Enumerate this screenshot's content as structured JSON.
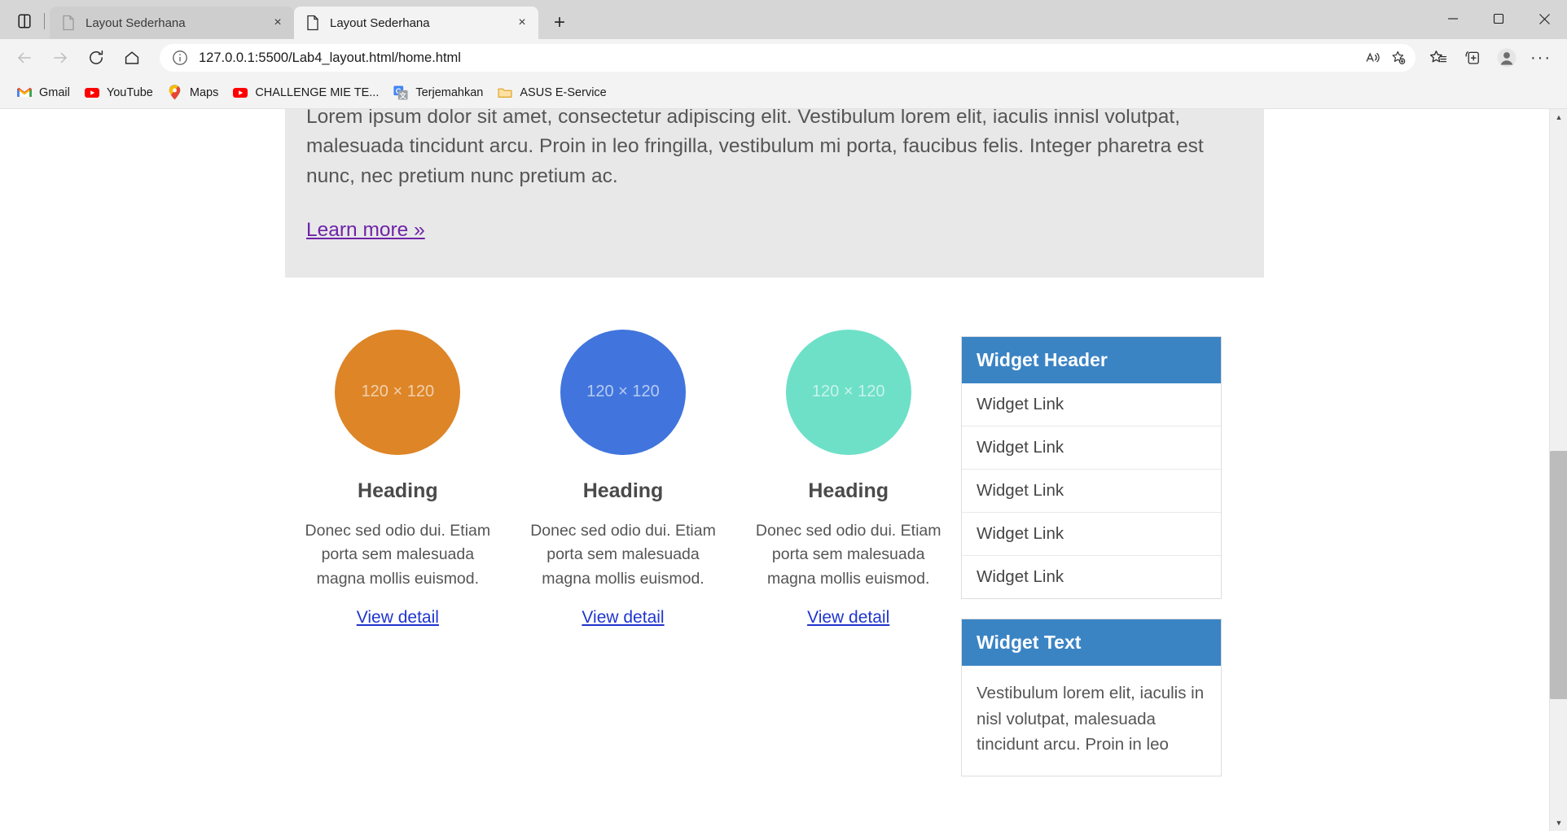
{
  "window": {
    "controls": {
      "minimize": "minimize-icon",
      "maximize": "maximize-icon",
      "close": "close-icon"
    }
  },
  "tabs": {
    "tab_search_label": "tab-actions-icon",
    "items": [
      {
        "title": "Layout Sederhana",
        "active": false,
        "close_label": "×"
      },
      {
        "title": "Layout Sederhana",
        "active": true,
        "close_label": "×"
      }
    ],
    "new_tab_label": "+"
  },
  "toolbar": {
    "back_label": "back-icon",
    "forward_label": "forward-icon",
    "refresh_label": "refresh-icon",
    "home_label": "home-icon",
    "url": "127.0.0.1:5500/Lab4_layout.html/home.html",
    "url_host": "127.0.0.1",
    "url_rest": ":5500/Lab4_layout.html/home.html",
    "read_aloud_label": "read-aloud-icon",
    "add_favorite_label": "add-favorite-icon",
    "favorites_label": "favorites-icon",
    "collections_label": "collections-icon",
    "profile_label": "profile-icon",
    "settings_label": "···"
  },
  "bookmarks": [
    {
      "label": "Gmail",
      "icon": "gmail-icon"
    },
    {
      "label": "YouTube",
      "icon": "youtube-icon"
    },
    {
      "label": "Maps",
      "icon": "google-maps-icon"
    },
    {
      "label": "CHALLENGE MIE TE...",
      "icon": "youtube-icon"
    },
    {
      "label": "Terjemahkan",
      "icon": "google-translate-icon"
    },
    {
      "label": "ASUS E-Service",
      "icon": "folder-icon"
    }
  ],
  "page": {
    "jumbotron": {
      "paragraph": "Lorem ipsum dolor sit amet, consectetur adipiscing elit. Vestibulum lorem elit, iaculis innisl volutpat, malesuada tincidunt arcu. Proin in leo fringilla, vestibulum mi porta, faucibus felis. Integer pharetra est nunc, nec pretium nunc pretium ac.",
      "learn_more": "Learn more »"
    },
    "columns": [
      {
        "placeholder": "120 × 120",
        "color": "#dd8527",
        "heading": "Heading",
        "body": "Donec sed odio dui. Etiam porta sem malesuada magna mollis euismod.",
        "link": "View detail"
      },
      {
        "placeholder": "120 × 120",
        "color": "#4175dd",
        "heading": "Heading",
        "body": "Donec sed odio dui. Etiam porta sem malesuada magna mollis euismod.",
        "link": "View detail"
      },
      {
        "placeholder": "120 × 120",
        "color": "#6ee0c8",
        "heading": "Heading",
        "body": "Donec sed odio dui. Etiam porta sem malesuada magna mollis euismod.",
        "link": "View detail"
      }
    ],
    "sidebar": {
      "widget_header": "Widget Header",
      "links": [
        "Widget Link",
        "Widget Link",
        "Widget Link",
        "Widget Link",
        "Widget Link"
      ],
      "text_widget_header": "Widget Text",
      "text_widget_body": "Vestibulum lorem elit, iaculis in nisl volutpat, malesuada tincidunt arcu. Proin in leo"
    }
  },
  "colors": {
    "widget_accent": "#3b84c4",
    "link_blue": "#1f35ce",
    "link_visited": "#6f23a8",
    "jumbo_bg": "#e8e8e8"
  },
  "scrollbar": {
    "up": "▲",
    "down": "▼"
  }
}
